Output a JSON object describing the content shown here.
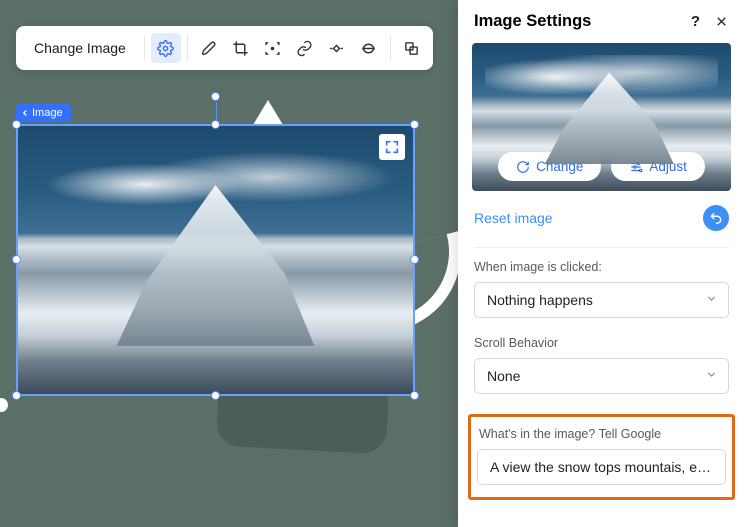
{
  "toolbar": {
    "change_image": "Change Image",
    "icons": {
      "settings": "settings-gear-icon",
      "brush": "brush-icon",
      "crop": "crop-icon",
      "focus": "focal-point-icon",
      "link": "link-icon",
      "animation": "animation-icon",
      "shape": "shape-mask-icon",
      "copy": "copy-style-icon"
    }
  },
  "breadcrumb": {
    "label": "Image"
  },
  "selection": {
    "expand_name": "expand-icon"
  },
  "panel": {
    "title": "Image Settings",
    "help_name": "help-icon",
    "close_name": "close-icon",
    "change_btn": "Change",
    "adjust_btn": "Adjust",
    "reset_link": "Reset image",
    "reset_icon_name": "undo-icon",
    "click_label": "When image is clicked:",
    "click_value": "Nothing happens",
    "scroll_label": "Scroll Behavior",
    "scroll_value": "None",
    "alt_label": "What's in the image? Tell Google",
    "alt_value": "A view the snow tops mountais, ever…"
  }
}
